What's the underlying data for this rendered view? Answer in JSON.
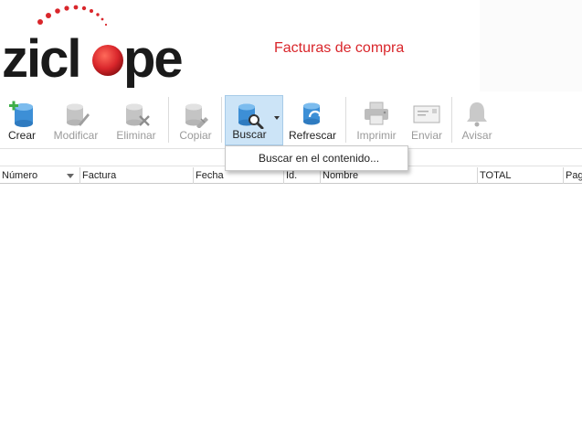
{
  "header": {
    "logo_text": "ziclope",
    "page_title": "Facturas de compra"
  },
  "toolbar": {
    "buttons": [
      {
        "label": "Crear",
        "icon": "database-add-icon",
        "enabled": true
      },
      {
        "label": "Modificar",
        "icon": "database-edit-icon",
        "enabled": false
      },
      {
        "label": "Eliminar",
        "icon": "database-delete-icon",
        "enabled": false
      },
      {
        "label": "Copiar",
        "icon": "database-copy-icon",
        "enabled": false
      },
      {
        "label": "Buscar",
        "icon": "database-search-icon",
        "enabled": true,
        "active": true
      },
      {
        "label": "Refrescar",
        "icon": "database-refresh-icon",
        "enabled": true
      },
      {
        "label": "Imprimir",
        "icon": "printer-icon",
        "enabled": false
      },
      {
        "label": "Enviar",
        "icon": "envelope-icon",
        "enabled": false
      },
      {
        "label": "Avisar",
        "icon": "bell-icon",
        "enabled": false
      }
    ]
  },
  "search_menu": {
    "items": [
      "Buscar en el contenido..."
    ]
  },
  "grid": {
    "columns": [
      "Número",
      "Factura",
      "Fecha",
      "Id.",
      "Nombre",
      "TOTAL",
      "Pag"
    ]
  },
  "colors": {
    "title_red": "#d9262b",
    "db_blue": "#3d8fd6",
    "active_bg": "#cce4f7"
  }
}
